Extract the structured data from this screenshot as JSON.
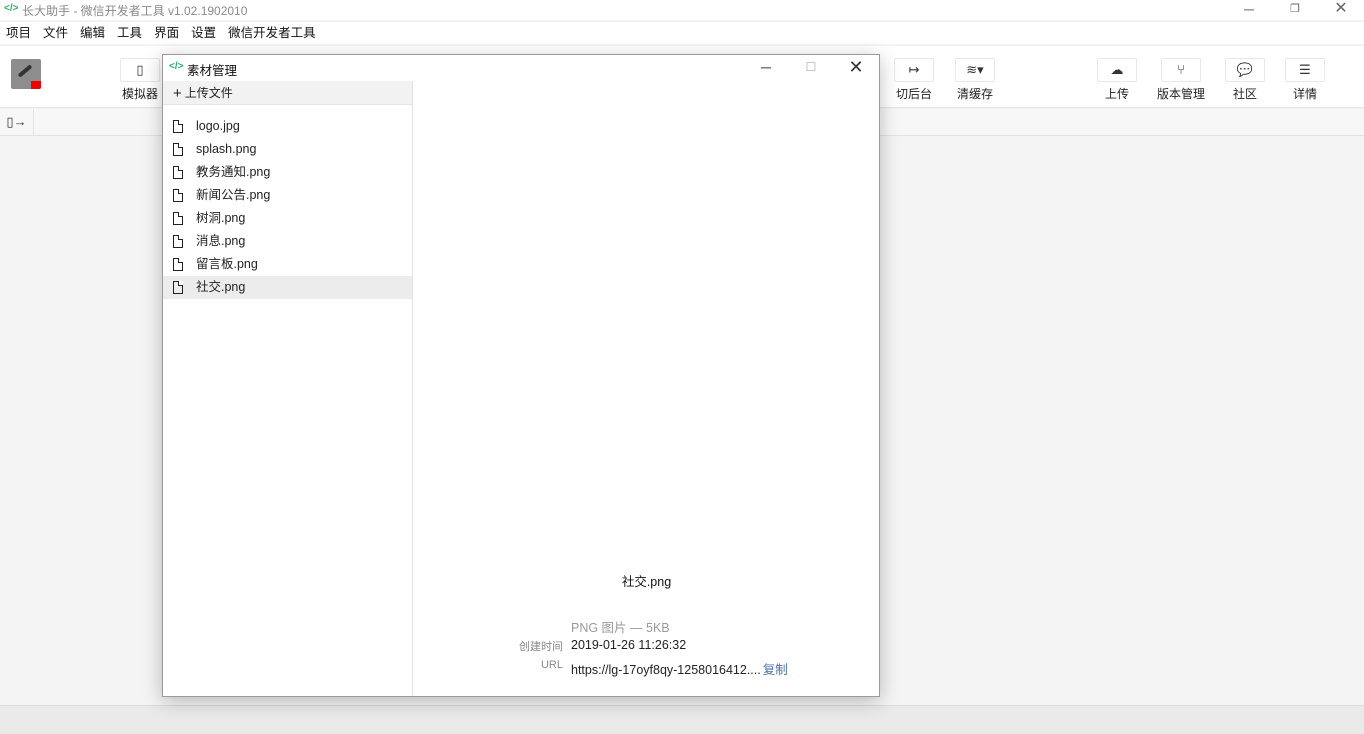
{
  "window": {
    "title": "长大助手 - 微信开发者工具 v1.02.1902010",
    "icon": "code-brackets-icon",
    "controls": {
      "minimize": "─",
      "restore": "❐",
      "close": "✕"
    }
  },
  "menu": [
    "项目",
    "文件",
    "编辑",
    "工具",
    "界面",
    "设置",
    "微信开发者工具"
  ],
  "toolbar": {
    "left": [
      {
        "label": "模拟器",
        "icon": "phone-icon",
        "glyph": "▯"
      }
    ],
    "middle": [
      {
        "label": "切后台",
        "icon": "switch-background-icon",
        "glyph": "↦"
      },
      {
        "label": "清缓存",
        "icon": "layers-icon",
        "glyph": "≋▾"
      }
    ],
    "right": [
      {
        "label": "上传",
        "icon": "cloud-upload-icon",
        "glyph": "☁"
      },
      {
        "label": "版本管理",
        "icon": "branch-icon",
        "glyph": "⑂"
      },
      {
        "label": "社区",
        "icon": "chat-bubble-icon",
        "glyph": "💬"
      },
      {
        "label": "详情",
        "icon": "menu-icon",
        "glyph": "☰"
      }
    ]
  },
  "subbar": {
    "toggle_glyph": "▯→"
  },
  "dialog": {
    "title": "素材管理",
    "controls": {
      "minimize": "─",
      "maximize": "☐",
      "close": "✕"
    },
    "upload_label": "上传文件",
    "files": [
      {
        "name": "logo.jpg",
        "selected": false
      },
      {
        "name": "splash.png",
        "selected": false
      },
      {
        "name": "教务通知.png",
        "selected": false
      },
      {
        "name": "新闻公告.png",
        "selected": false
      },
      {
        "name": "树洞.png",
        "selected": false
      },
      {
        "name": "消息.png",
        "selected": false
      },
      {
        "name": "留言板.png",
        "selected": false
      },
      {
        "name": "社交.png",
        "selected": true
      }
    ],
    "preview": {
      "name": "社交.png",
      "type_size": "PNG 图片 — 5KB",
      "created_label": "创建时间",
      "created_value": "2019-01-26 11:26:32",
      "url_label": "URL",
      "url_value": "https://lg-17oyf8qy-1258016412....",
      "copy_label": "复制"
    }
  }
}
